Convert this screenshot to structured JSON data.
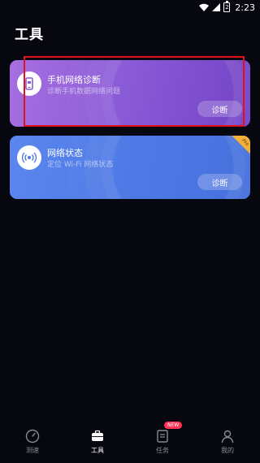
{
  "status_bar": {
    "battery_level": "2",
    "time": "2:23"
  },
  "header": {
    "title": "工具"
  },
  "cards": [
    {
      "title": "手机网络诊断",
      "subtitle": "诊断手机数据网络问题",
      "button_label": "诊断",
      "icon": "phone-network-icon",
      "color": "#8b5cd8"
    },
    {
      "title": "网络状态",
      "subtitle": "定位 Wi-Fi 网络状态",
      "button_label": "诊断",
      "icon": "wifi-signal-icon",
      "badge": "Pro",
      "color": "#4f7ae6"
    }
  ],
  "bottom_nav": {
    "items": [
      {
        "label": "测速",
        "icon": "speedometer-icon",
        "active": false
      },
      {
        "label": "工具",
        "icon": "toolbox-icon",
        "active": true
      },
      {
        "label": "任务",
        "icon": "task-list-icon",
        "active": false,
        "badge": "NEW"
      },
      {
        "label": "我的",
        "icon": "person-icon",
        "active": false
      }
    ]
  },
  "colors": {
    "background": "#07070f",
    "highlight": "#e0101c",
    "badge_new": "#ff3355",
    "badge_pro": "#f2b03b"
  }
}
